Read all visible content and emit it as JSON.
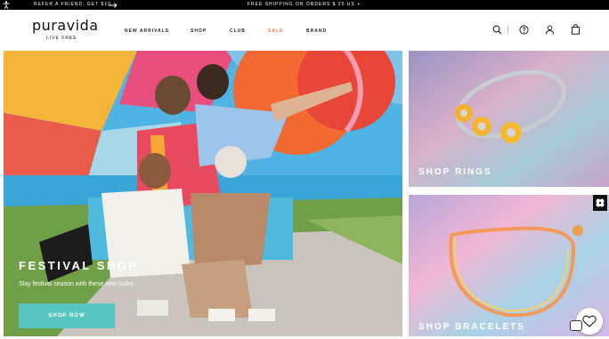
{
  "promo": {
    "refer_text": "REFER A FRIEND, GET $10",
    "shipping_text": "FREE SHIPPING ON ORDERS $ 25 US +"
  },
  "header": {
    "logo_word": "puravida",
    "logo_tagline": "LIVE FREE",
    "nav": [
      "NEW ARRIVALS",
      "SHOP",
      "CLUB",
      "SALE",
      "BRAND"
    ],
    "sale_color": "#f07a3f",
    "icons": [
      "search-icon",
      "help-icon",
      "account-icon",
      "bag-icon"
    ]
  },
  "hero": {
    "title": "FESTIVAL SHOP",
    "subtitle": "Slay festival season with these new looks.",
    "button_label": "SHOP NOW",
    "button_color": "#57c6c0"
  },
  "tiles": [
    {
      "label": "SHOP RINGS"
    },
    {
      "label": "SHOP BRACELETS"
    }
  ],
  "widgets": {
    "badge_icon": "clover-icon",
    "chat_icon": "chat-heart-icon"
  }
}
